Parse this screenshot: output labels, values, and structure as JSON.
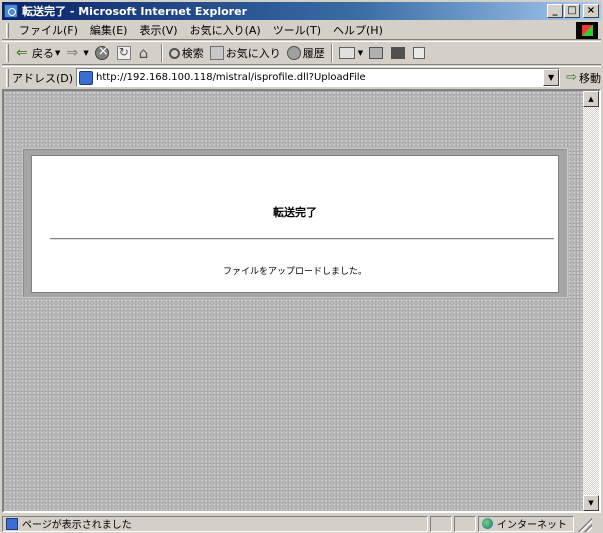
{
  "window": {
    "title": "転送完了 - Microsoft Internet Explorer",
    "minimize": "_",
    "maximize": "□",
    "close": "×"
  },
  "menu": [
    "ファイル(F)",
    "編集(E)",
    "表示(V)",
    "お気に入り(A)",
    "ツール(T)",
    "ヘルプ(H)"
  ],
  "toolbar": {
    "back": "戻る",
    "search": "検索",
    "favorites": "お気に入り",
    "history": "履歴"
  },
  "address": {
    "label": "アドレス(D)",
    "url": "http://192.168.100.118/mistral/isprofile.dll?UploadFile",
    "go": "移動"
  },
  "page": {
    "heading": "転送完了",
    "message": "ファイルをアップロードしました。"
  },
  "status": {
    "text": "ページが表示されました",
    "zone": "インターネット"
  },
  "icons": [
    "ie-icon",
    "back-icon",
    "forward-icon",
    "stop-icon",
    "refresh-icon",
    "home-icon",
    "search-icon",
    "favorites-icon",
    "history-icon",
    "mail-icon",
    "print-icon",
    "edit-icon",
    "discuss-icon",
    "globe-icon"
  ]
}
